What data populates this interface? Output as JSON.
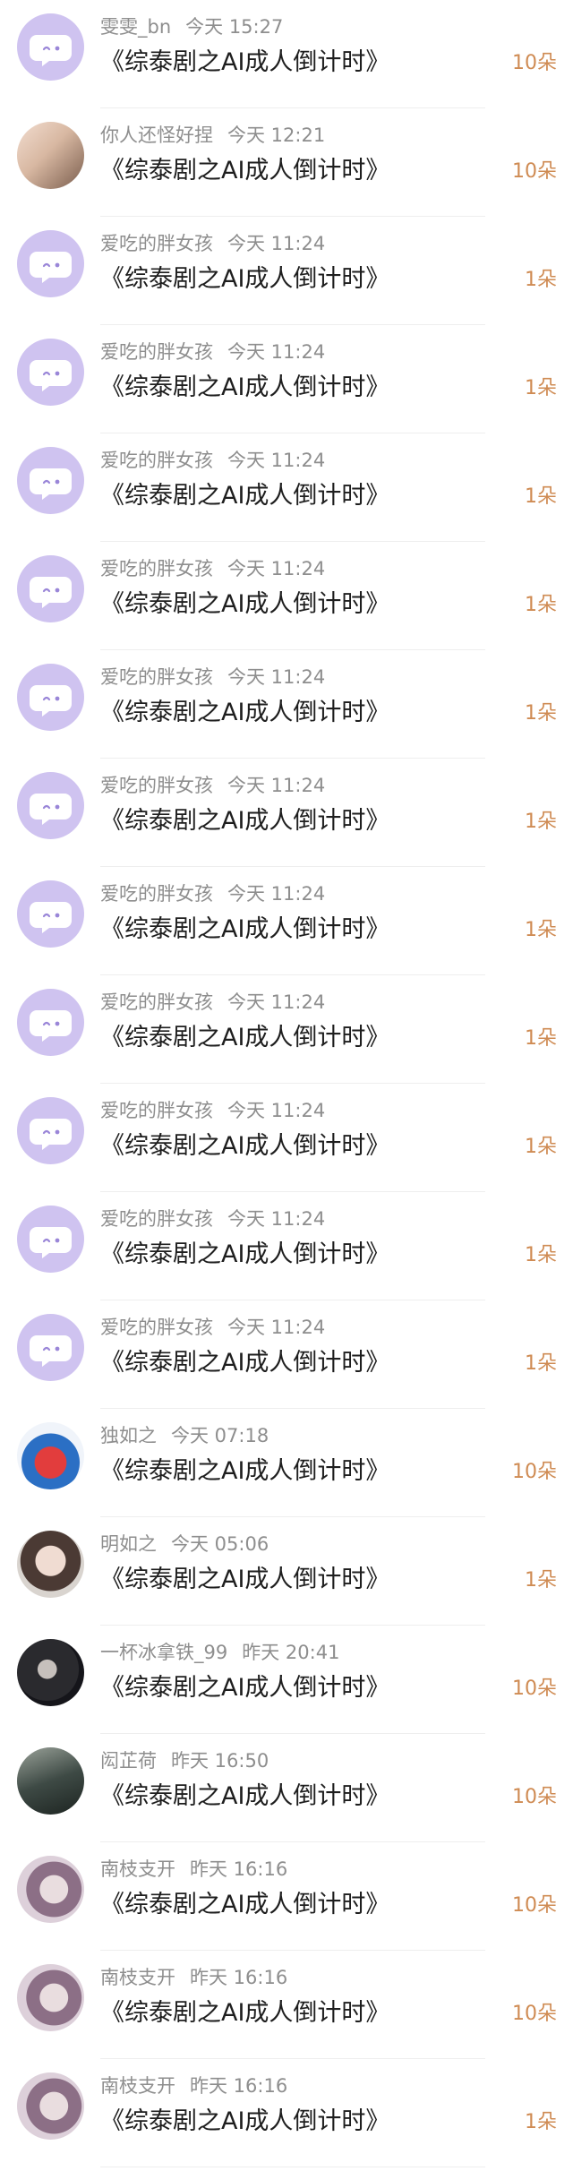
{
  "colors": {
    "avatar_purple": "#cfc3f0",
    "amount_orange": "#cf8b53",
    "meta_gray": "#8e8e8e",
    "title_dark": "#1e1e1e"
  },
  "rows": [
    {
      "name": "雯雯_bn",
      "time": "今天 15:27",
      "title": "《综泰剧之AI成人倒计时》",
      "amount": "10朵",
      "avatar": "purple-chat-icon"
    },
    {
      "name": "你人还怪好捏",
      "time": "今天 12:21",
      "title": "《综泰剧之AI成人倒计时》",
      "amount": "10朵",
      "avatar": "user-photo"
    },
    {
      "name": "爱吃的胖女孩",
      "time": "今天 11:24",
      "title": "《综泰剧之AI成人倒计时》",
      "amount": "1朵",
      "avatar": "purple-chat-icon"
    },
    {
      "name": "爱吃的胖女孩",
      "time": "今天 11:24",
      "title": "《综泰剧之AI成人倒计时》",
      "amount": "1朵",
      "avatar": "purple-chat-icon"
    },
    {
      "name": "爱吃的胖女孩",
      "time": "今天 11:24",
      "title": "《综泰剧之AI成人倒计时》",
      "amount": "1朵",
      "avatar": "purple-chat-icon"
    },
    {
      "name": "爱吃的胖女孩",
      "time": "今天 11:24",
      "title": "《综泰剧之AI成人倒计时》",
      "amount": "1朵",
      "avatar": "purple-chat-icon"
    },
    {
      "name": "爱吃的胖女孩",
      "time": "今天 11:24",
      "title": "《综泰剧之AI成人倒计时》",
      "amount": "1朵",
      "avatar": "purple-chat-icon"
    },
    {
      "name": "爱吃的胖女孩",
      "time": "今天 11:24",
      "title": "《综泰剧之AI成人倒计时》",
      "amount": "1朵",
      "avatar": "purple-chat-icon"
    },
    {
      "name": "爱吃的胖女孩",
      "time": "今天 11:24",
      "title": "《综泰剧之AI成人倒计时》",
      "amount": "1朵",
      "avatar": "purple-chat-icon"
    },
    {
      "name": "爱吃的胖女孩",
      "time": "今天 11:24",
      "title": "《综泰剧之AI成人倒计时》",
      "amount": "1朵",
      "avatar": "purple-chat-icon"
    },
    {
      "name": "爱吃的胖女孩",
      "time": "今天 11:24",
      "title": "《综泰剧之AI成人倒计时》",
      "amount": "1朵",
      "avatar": "purple-chat-icon"
    },
    {
      "name": "爱吃的胖女孩",
      "time": "今天 11:24",
      "title": "《综泰剧之AI成人倒计时》",
      "amount": "1朵",
      "avatar": "purple-chat-icon"
    },
    {
      "name": "爱吃的胖女孩",
      "time": "今天 11:24",
      "title": "《综泰剧之AI成人倒计时》",
      "amount": "1朵",
      "avatar": "purple-chat-icon"
    },
    {
      "name": "独如之",
      "time": "今天 07:18",
      "title": "《综泰剧之AI成人倒计时》",
      "amount": "10朵",
      "avatar": "user-photo"
    },
    {
      "name": "明如之",
      "time": "今天 05:06",
      "title": "《综泰剧之AI成人倒计时》",
      "amount": "1朵",
      "avatar": "user-photo"
    },
    {
      "name": "一杯冰拿铁_99",
      "time": "昨天 20:41",
      "title": "《综泰剧之AI成人倒计时》",
      "amount": "10朵",
      "avatar": "user-photo"
    },
    {
      "name": "闳芷荷",
      "time": "昨天 16:50",
      "title": "《综泰剧之AI成人倒计时》",
      "amount": "10朵",
      "avatar": "user-photo"
    },
    {
      "name": "南枝支开",
      "time": "昨天 16:16",
      "title": "《综泰剧之AI成人倒计时》",
      "amount": "10朵",
      "avatar": "user-photo"
    },
    {
      "name": "南枝支开",
      "time": "昨天 16:16",
      "title": "《综泰剧之AI成人倒计时》",
      "amount": "10朵",
      "avatar": "user-photo"
    },
    {
      "name": "南枝支开",
      "time": "昨天 16:16",
      "title": "《综泰剧之AI成人倒计时》",
      "amount": "1朵",
      "avatar": "user-photo"
    }
  ]
}
